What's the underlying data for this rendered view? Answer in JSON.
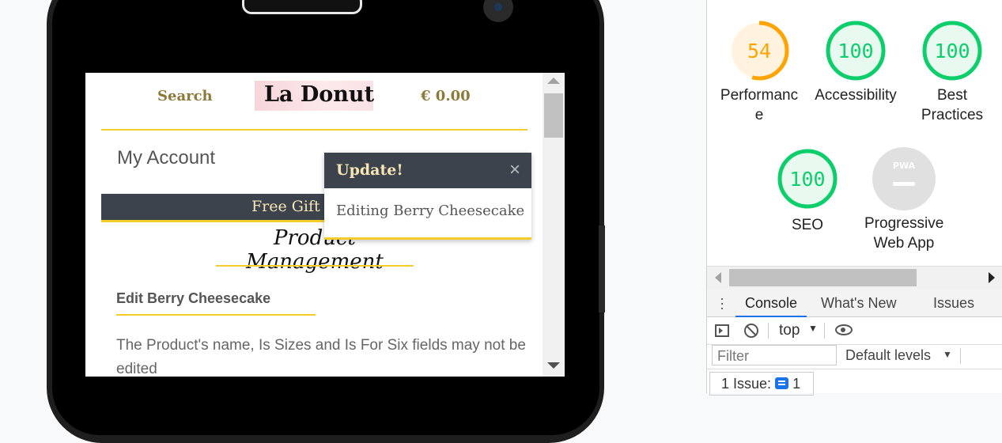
{
  "site": {
    "search_label": "Search",
    "logo_text": "La Donut",
    "cart_total": "€ 0.00",
    "my_account": "My Account",
    "promo_banner": "Free Gift Presen",
    "section_title": "Product Management",
    "edit_heading": "Edit Berry Cheesecake",
    "notice": "The Product's name, Is Sizes and Is For Six fields may not be edited"
  },
  "toast": {
    "title": "Update!",
    "close": "×",
    "message": "Editing Berry Cheesecake"
  },
  "lighthouse": {
    "scores": [
      {
        "label": "Performance",
        "value": "54",
        "fraction": 0.54,
        "color": "#ffa400"
      },
      {
        "label": "Accessibility",
        "value": "100",
        "fraction": 1.0,
        "color": "#0cce6b"
      },
      {
        "label": "Best Practices",
        "value": "100",
        "fraction": 1.0,
        "color": "#0cce6b"
      },
      {
        "label": "SEO",
        "value": "100",
        "fraction": 1.0,
        "color": "#0cce6b"
      }
    ],
    "pwa": {
      "label": "Progressive Web App",
      "badge": "PWA"
    }
  },
  "devtools": {
    "tabs": [
      "Console",
      "What's New",
      "Issues"
    ],
    "active_tab": "Console",
    "context": "top",
    "filter_placeholder": "Filter",
    "levels": "Default levels",
    "issue_label": "1 Issue:",
    "issue_count": "1"
  }
}
